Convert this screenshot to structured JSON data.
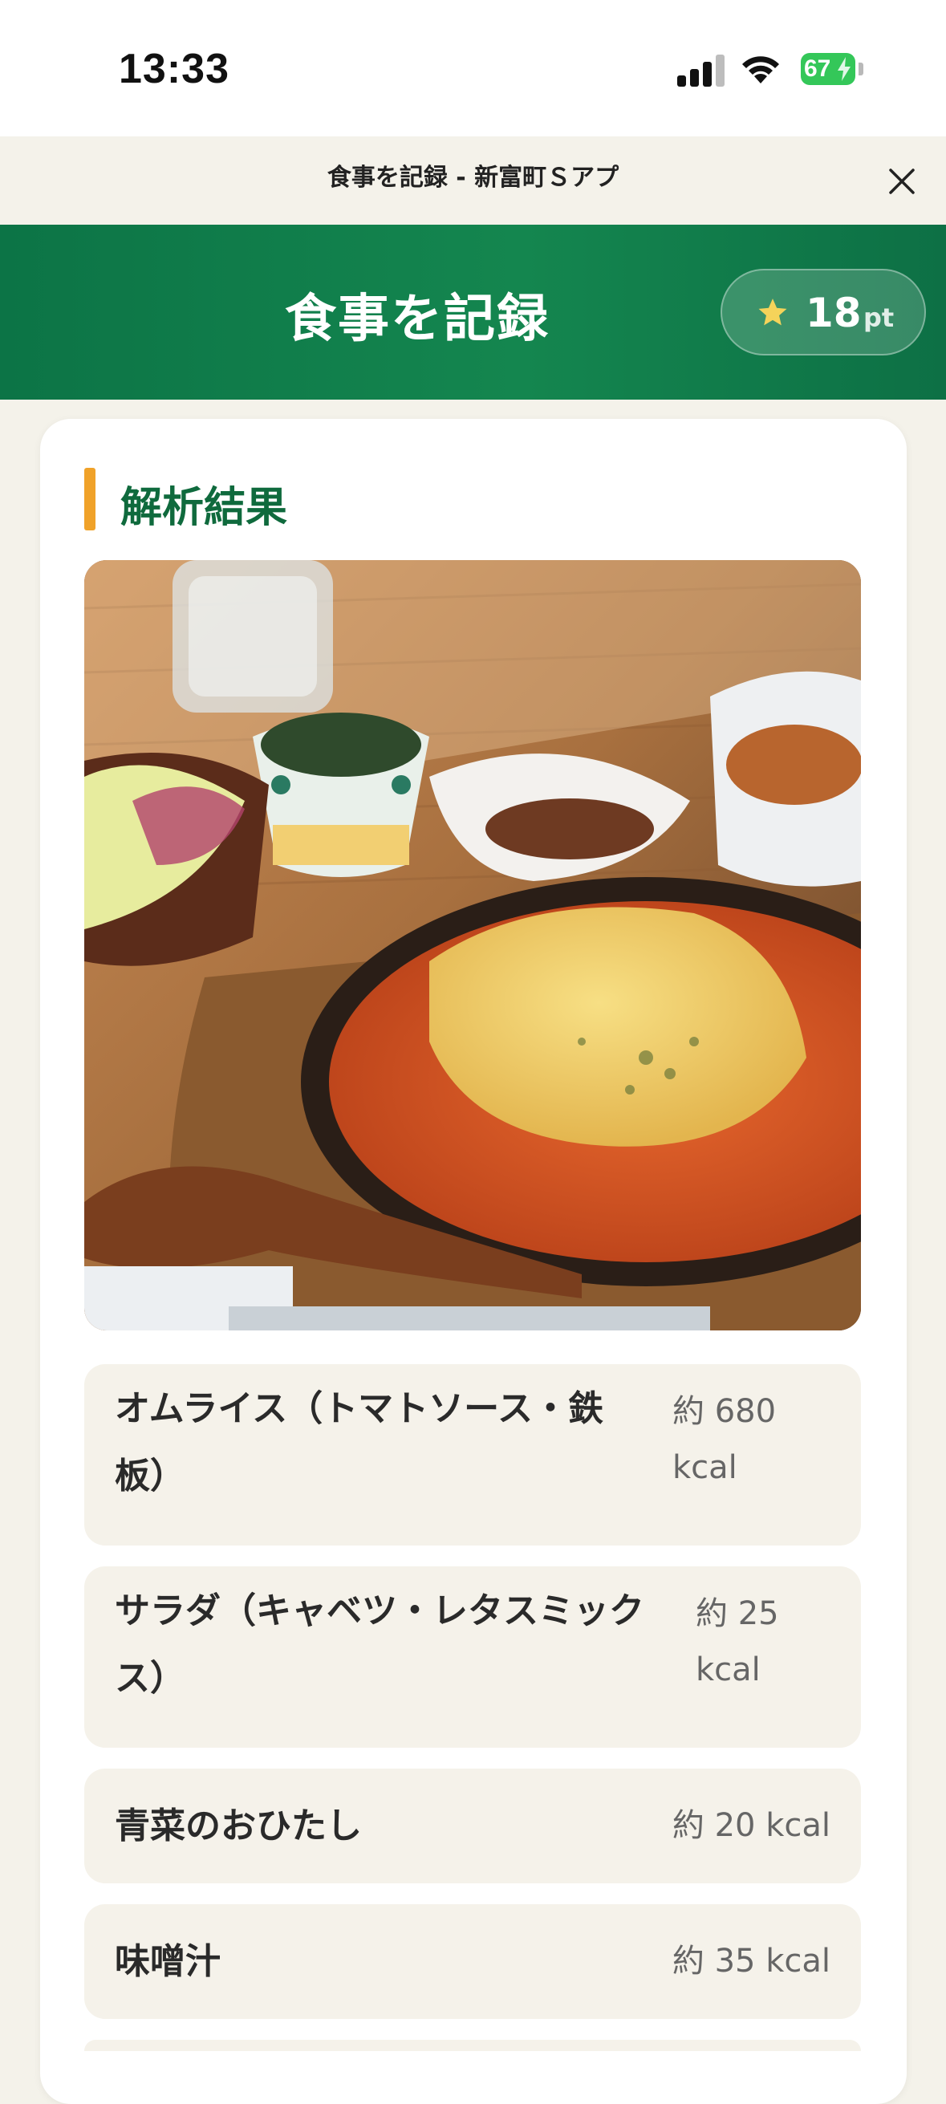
{
  "status_bar": {
    "time": "13:33",
    "battery": "67",
    "icons": [
      "cellular-signal-icon",
      "wifi-icon",
      "battery-charging-icon"
    ]
  },
  "browser": {
    "title": "食事を記録 - 新富町Ｓアプ",
    "close_icon": "close-icon"
  },
  "header": {
    "title": "食事を記録",
    "points": "18",
    "points_unit": "pt",
    "star_icon": "star-icon",
    "colors": {
      "primary": "#0c7446",
      "star": "#f5d35a"
    }
  },
  "result": {
    "section_title": "解析結果",
    "accent_color": "#f0a229",
    "items": [
      {
        "name_line1": "オムライス（トマトソース・鉄",
        "name_line2": "板）",
        "kcal_line1": "約 680",
        "kcal_line2": "kcal"
      },
      {
        "name_line1": "サラダ（キャベツ・レタスミック",
        "name_line2": "ス）",
        "kcal_line1": "約 25",
        "kcal_line2": "kcal"
      },
      {
        "name": "青菜のおひたし",
        "kcal": "約 20 kcal"
      },
      {
        "name": "味噌汁",
        "kcal": "約 35 kcal"
      }
    ]
  }
}
